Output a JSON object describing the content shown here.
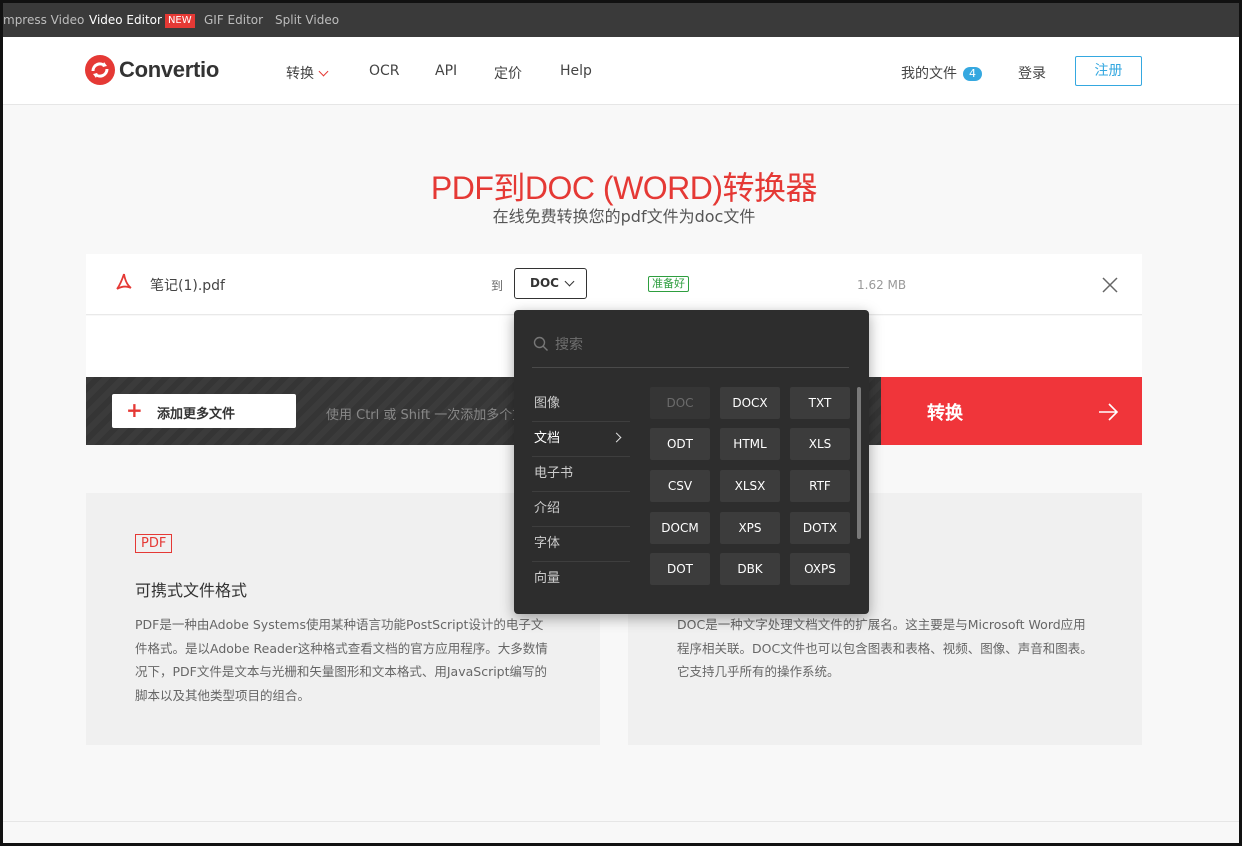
{
  "topbar": {
    "links": [
      "mpress Video",
      "Video Editor",
      "GIF Editor",
      "Split Video"
    ],
    "new_badge": "NEW"
  },
  "header": {
    "logo_text": "Convertio",
    "nav": [
      "转换",
      "OCR",
      "API",
      "定价",
      "Help"
    ],
    "my_files": "我的文件",
    "my_files_count": "4",
    "login": "登录",
    "register": "注册"
  },
  "hero": {
    "title": "PDF到DOC (WORD)转换器",
    "subtitle": "在线免费转换您的pdf文件为doc文件"
  },
  "file": {
    "name": "笔记(1).pdf",
    "to_label": "到",
    "format": "DOC",
    "status": "准备好",
    "size": "1.62 MB"
  },
  "actions": {
    "add_more": "添加更多文件",
    "hint": "使用 Ctrl 或 Shift 一次添加多个文件",
    "convert": "转换"
  },
  "dropdown": {
    "search_placeholder": "搜索",
    "categories": [
      "图像",
      "文档",
      "电子书",
      "介绍",
      "字体",
      "向量"
    ],
    "active_category": "文档",
    "formats": [
      "DOC",
      "DOCX",
      "TXT",
      "ODT",
      "HTML",
      "XLS",
      "CSV",
      "XLSX",
      "RTF",
      "DOCM",
      "XPS",
      "DOTX",
      "DOT",
      "DBK",
      "OXPS"
    ],
    "disabled_format": "DOC"
  },
  "cards": [
    {
      "tag": "PDF",
      "title": "可携式文件格式",
      "desc": "PDF是一种由Adobe Systems使用某种语言功能PostScript设计的电子文件格式。是以Adobe Reader这种格式查看文档的官方应用程序。大多数情况下，PDF文件是文本与光栅和矢量图形和文本格式、用JavaScript编写的脚本以及其他类型项目的组合。"
    },
    {
      "desc": "DOC是一种文字处理文档文件的扩展名。这主要是与Microsoft Word应用程序相关联。DOC文件也可以包含图表和表格、视频、图像、声音和图表。它支持几乎所有的操作系统。"
    }
  ],
  "colors": {
    "brand_red": "#e53935",
    "link_blue": "#35a8e0",
    "ready_green": "#2e9e3f"
  }
}
